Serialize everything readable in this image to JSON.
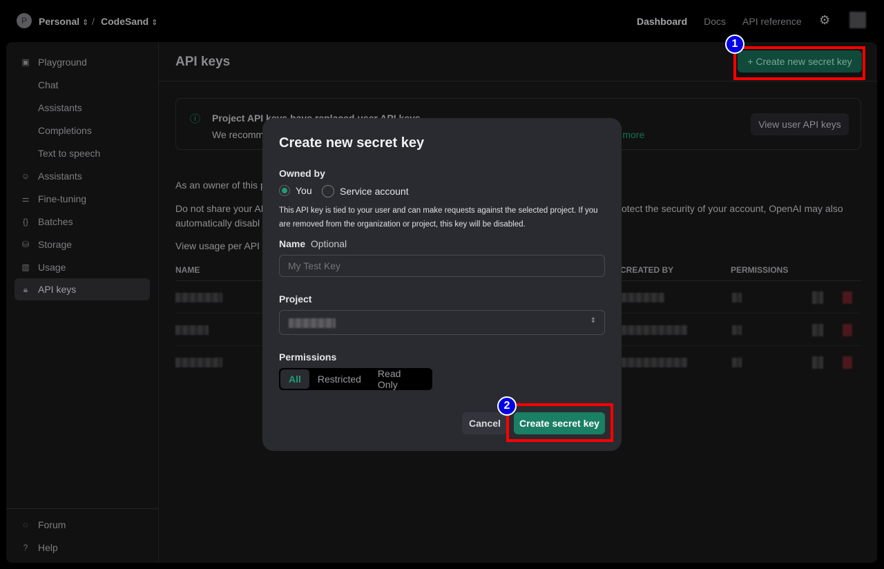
{
  "topbar": {
    "org_initial": "P",
    "org": "Personal",
    "separator": "/",
    "project": "CodeSand",
    "nav": [
      "Dashboard",
      "Docs",
      "API reference"
    ]
  },
  "sidebar": {
    "items": [
      {
        "label": "Playground",
        "icon": "terminal-icon"
      },
      {
        "label": "Chat",
        "sub": true
      },
      {
        "label": "Assistants",
        "sub": true
      },
      {
        "label": "Completions",
        "sub": true
      },
      {
        "label": "Text to speech",
        "sub": true
      },
      {
        "label": "Assistants",
        "icon": "robot-icon"
      },
      {
        "label": "Fine-tuning",
        "icon": "sliders-icon"
      },
      {
        "label": "Batches",
        "icon": "braces-icon"
      },
      {
        "label": "Storage",
        "icon": "database-icon"
      },
      {
        "label": "Usage",
        "icon": "bar-chart-icon"
      },
      {
        "label": "API keys",
        "icon": "lock-icon",
        "active": true
      }
    ],
    "footer": [
      {
        "label": "Forum",
        "icon": "chat-bubble-icon"
      },
      {
        "label": "Help",
        "icon": "help-icon"
      }
    ]
  },
  "main": {
    "title": "API keys",
    "create_button": "+ Create new secret key",
    "banner": {
      "title": "Project API keys have replaced user API keys",
      "text": "We recomm",
      "link": "rn more",
      "button": "View user API keys"
    },
    "para1": "As an owner of this p",
    "para2a": "Do not share your AP",
    "para2b": "otect the security of your account, OpenAI may also",
    "para2c": "automatically disabl",
    "para3": "View usage per API k",
    "columns": {
      "name": "NAME",
      "created_by": "CREATED BY",
      "permissions": "PERMISSIONS"
    }
  },
  "modal": {
    "title": "Create new secret key",
    "owned_by": "Owned by",
    "owner_options": [
      "You",
      "Service account"
    ],
    "owner_selected": "You",
    "help": "This API key is tied to your user and can make requests against the selected project. If you are removed from the organization or project, this key will be disabled.",
    "name_label": "Name",
    "name_optional": "Optional",
    "name_placeholder": "My Test Key",
    "project_label": "Project",
    "permissions_label": "Permissions",
    "permissions": [
      "All",
      "Restricted",
      "Read Only"
    ],
    "permissions_selected": "All",
    "cancel": "Cancel",
    "submit": "Create secret key"
  },
  "annotations": [
    "1",
    "2"
  ],
  "colors": {
    "accent": "#1a7f64",
    "highlight": "#ff0000",
    "badge": "#0000e6"
  }
}
